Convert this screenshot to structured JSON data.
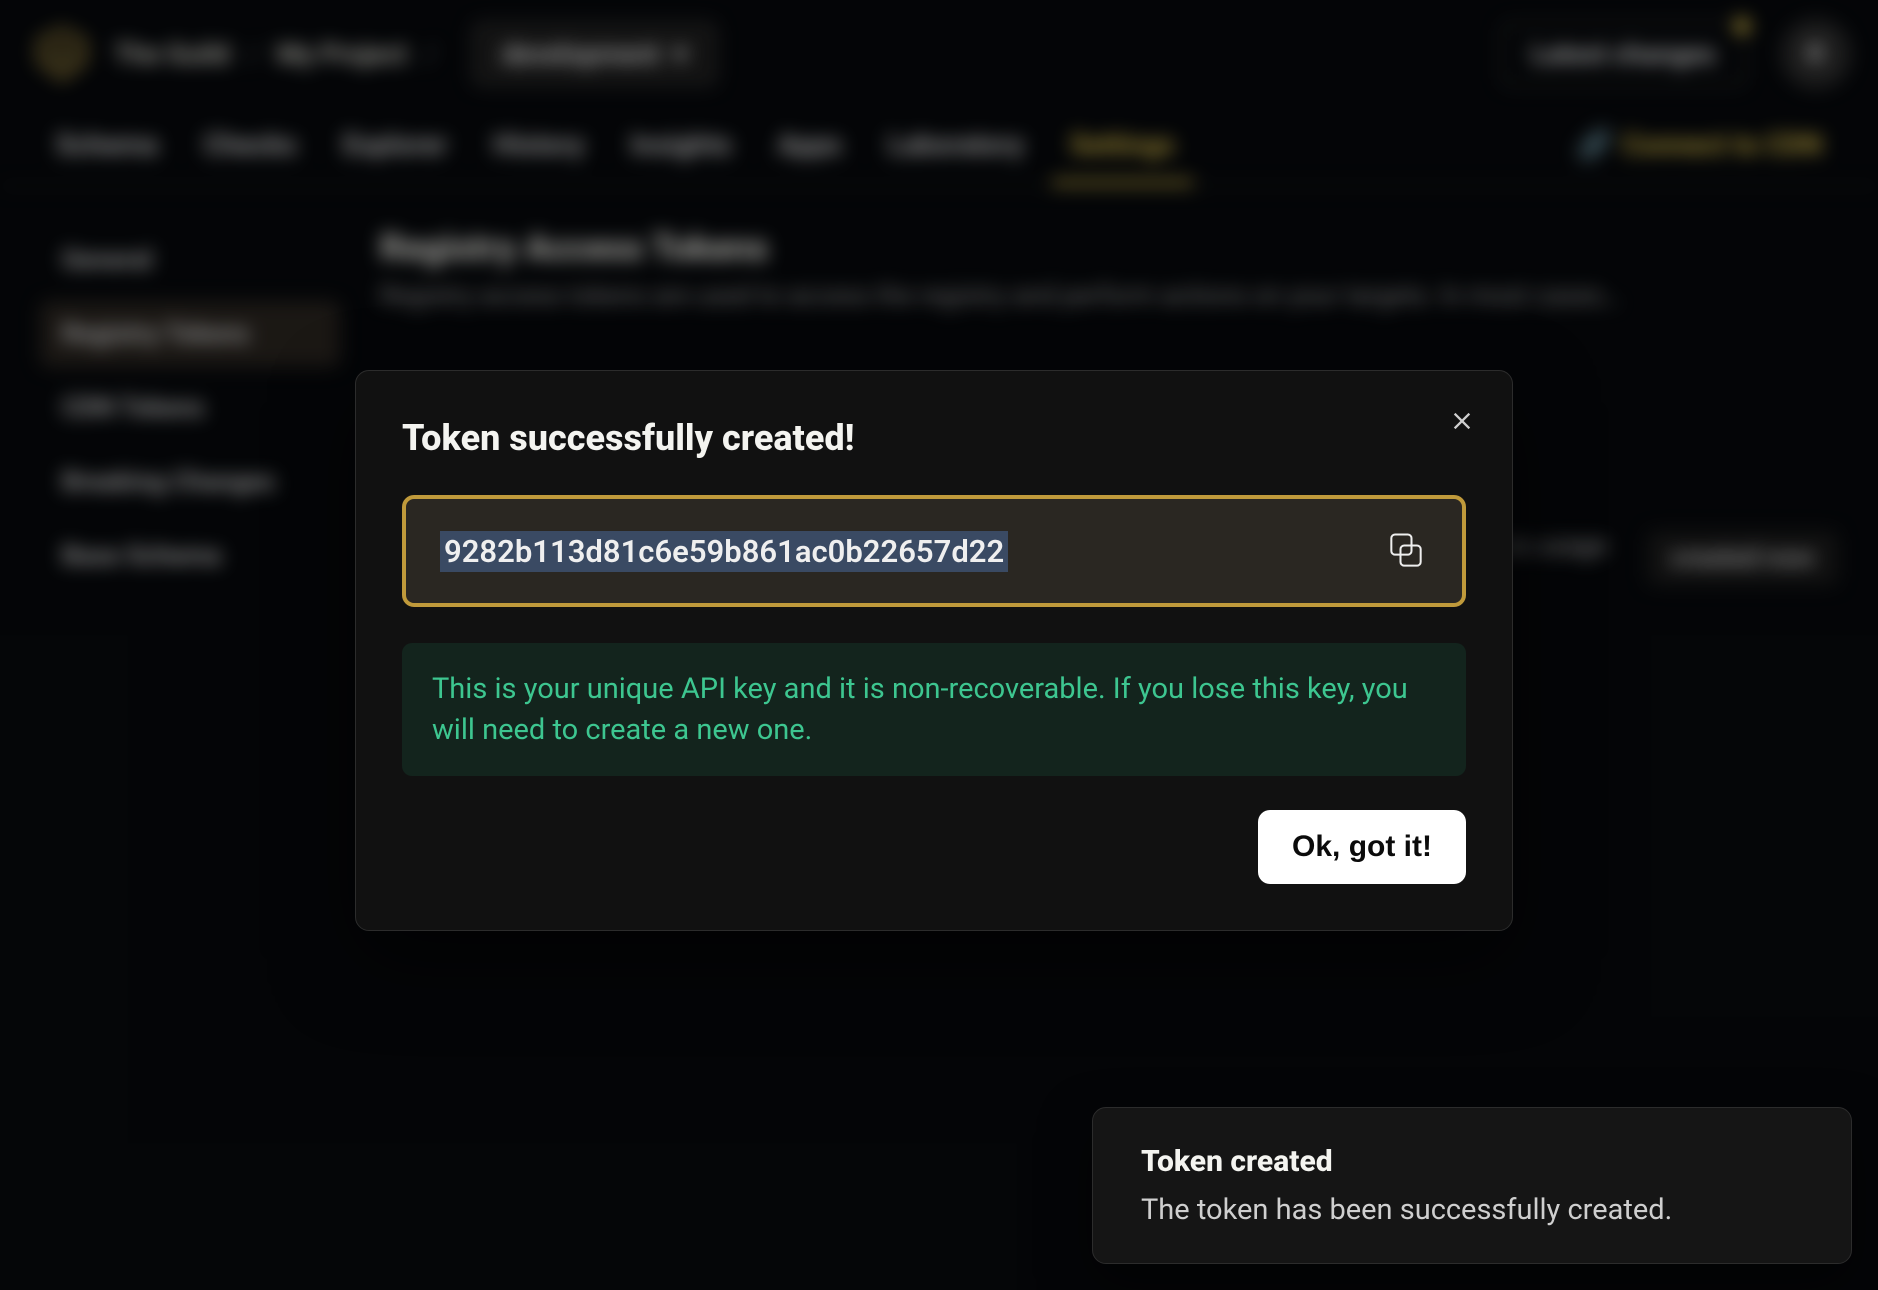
{
  "header": {
    "org": "The Guild",
    "project": "My Project",
    "env": "development",
    "latest_changes": "Latest changes",
    "avatar_initial": "K"
  },
  "tabs": {
    "items": [
      "Schema",
      "Checks",
      "Explorer",
      "History",
      "Insights",
      "Apps",
      "Laboratory",
      "Settings"
    ],
    "active_index": 7,
    "connect_cdn": "Connect to CDN"
  },
  "sidebar": {
    "items": [
      "General",
      "Registry Tokens",
      "CDN Tokens",
      "Breaking Changes",
      "Base Schema"
    ],
    "selected_index": 1
  },
  "page": {
    "heading": "Registry Access Tokens",
    "subheading": "Registry access tokens are used to access the registry and perform actions on your targets. In most cases…",
    "row_last_used": "no usage",
    "row_created": "created now"
  },
  "modal": {
    "title": "Token successfully created!",
    "token": "9282b113d81c6e59b861ac0b22657d22",
    "note": "This is your unique API key and it is non-recoverable. If you lose this key, you will need to create a new one.",
    "ok": "Ok, got it!"
  },
  "toast": {
    "title": "Token created",
    "body": "The token has been successfully created."
  }
}
